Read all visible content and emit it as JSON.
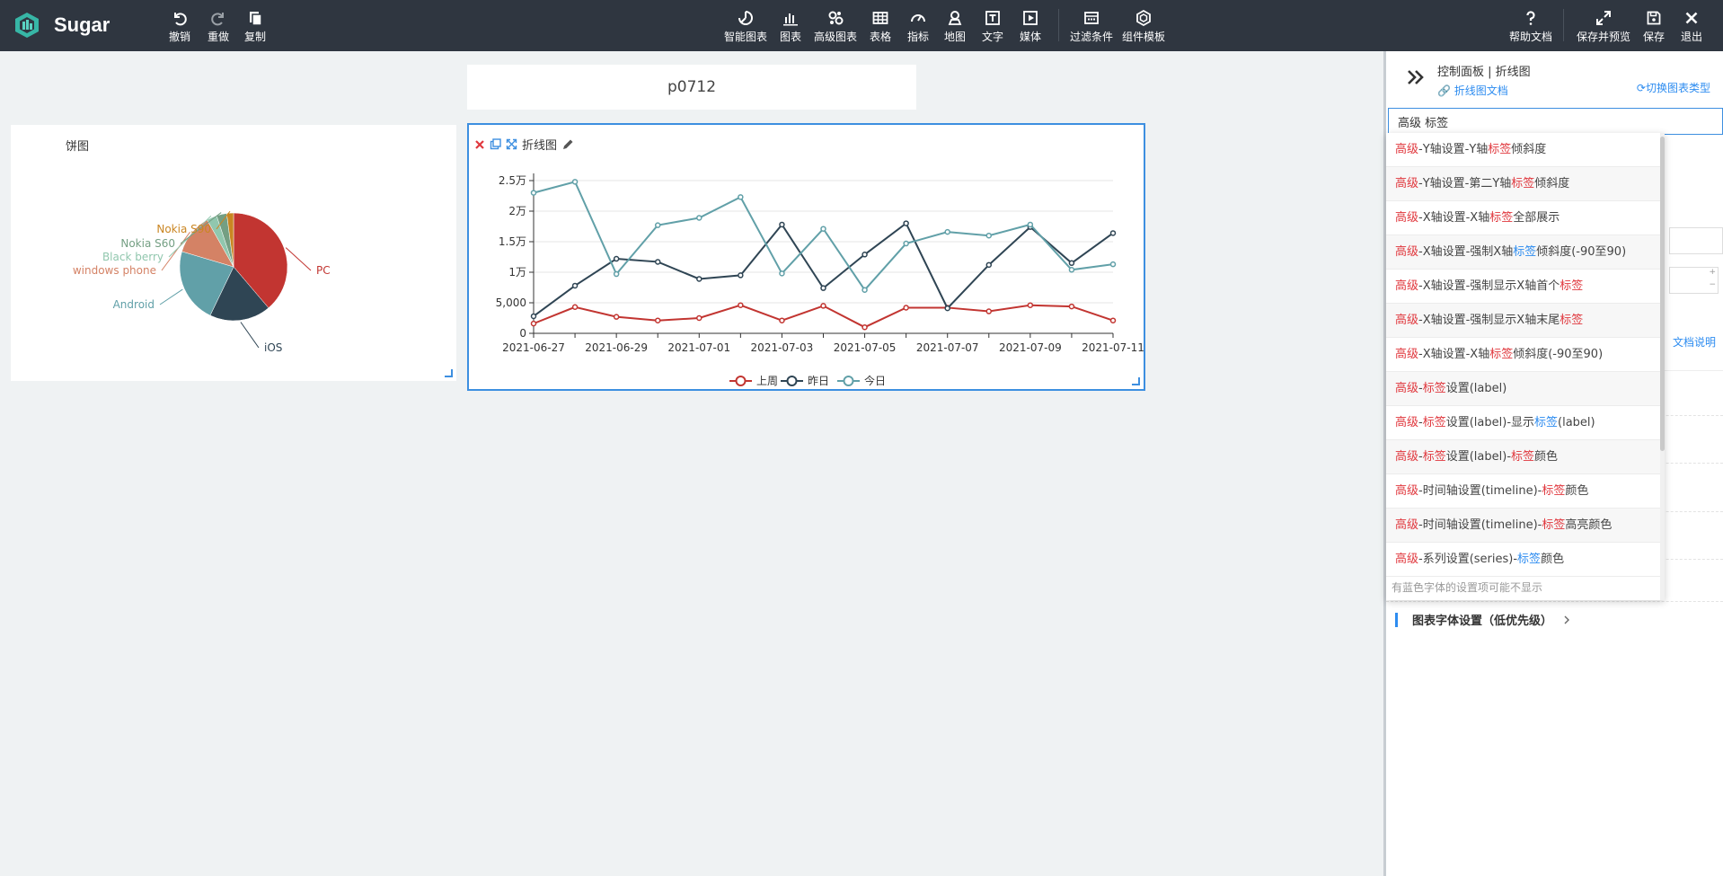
{
  "app": {
    "name": "Sugar"
  },
  "toolbar": {
    "left": [
      {
        "label": "撤销",
        "icon": "undo-icon"
      },
      {
        "label": "重做",
        "icon": "redo-icon"
      },
      {
        "label": "复制",
        "icon": "copy-icon"
      }
    ],
    "center": [
      {
        "label": "智能图表",
        "icon": "smart-chart-icon"
      },
      {
        "label": "图表",
        "icon": "bar-chart-icon"
      },
      {
        "label": "高级图表",
        "icon": "advanced-chart-icon"
      },
      {
        "label": "表格",
        "icon": "table-icon"
      },
      {
        "label": "指标",
        "icon": "gauge-icon"
      },
      {
        "label": "地图",
        "icon": "map-pin-icon"
      },
      {
        "label": "文字",
        "icon": "text-icon"
      },
      {
        "label": "媒体",
        "icon": "media-icon"
      },
      {
        "label": "过滤条件",
        "icon": "filter-icon"
      },
      {
        "label": "组件模板",
        "icon": "template-icon"
      }
    ],
    "right": [
      {
        "label": "帮助文档",
        "icon": "help-icon"
      },
      {
        "label": "保存并预览",
        "icon": "expand-icon"
      },
      {
        "label": "保存",
        "icon": "save-icon"
      },
      {
        "label": "退出",
        "icon": "close-icon"
      }
    ]
  },
  "page_title": "p0712",
  "pie_card": {
    "title": "饼图",
    "chart_data": {
      "type": "pie",
      "slices": [
        {
          "name": "PC",
          "value": 38,
          "color": "#c23531"
        },
        {
          "name": "iOS",
          "value": 18,
          "color": "#2f4554"
        },
        {
          "name": "Android",
          "value": 22,
          "color": "#61a0a8"
        },
        {
          "name": "windows phone",
          "value": 12,
          "color": "#d48265"
        },
        {
          "name": "Black berry",
          "value": 3,
          "color": "#91c7ae"
        },
        {
          "name": "Nokia S60",
          "value": 3,
          "color": "#749f83"
        },
        {
          "name": "Nokia S90",
          "value": 2,
          "color": "#ca8622"
        }
      ]
    }
  },
  "line_card": {
    "title": "折线图",
    "chart_data": {
      "type": "line",
      "x": [
        "2021-06-27",
        "2021-06-28",
        "2021-06-29",
        "2021-06-30",
        "2021-07-01",
        "2021-07-02",
        "2021-07-03",
        "2021-07-04",
        "2021-07-05",
        "2021-07-06",
        "2021-07-07",
        "2021-07-08",
        "2021-07-09",
        "2021-07-10",
        "2021-07-11"
      ],
      "x_ticks": [
        "2021-06-27",
        "2021-06-29",
        "2021-07-01",
        "2021-07-03",
        "2021-07-05",
        "2021-07-07",
        "2021-07-09",
        "2021-07-11"
      ],
      "y_ticks": [
        {
          "value": 0,
          "label": "0"
        },
        {
          "value": 5000,
          "label": "5,000"
        },
        {
          "value": 10000,
          "label": "1万"
        },
        {
          "value": 15000,
          "label": "1.5万"
        },
        {
          "value": 20000,
          "label": "2万"
        },
        {
          "value": 25000,
          "label": "2.5万"
        }
      ],
      "ylim": [
        0,
        25000
      ],
      "grid": true,
      "legend": "bottom",
      "series": [
        {
          "name": "上周",
          "color": "#c23531",
          "values": [
            1600,
            4300,
            2700,
            2100,
            2500,
            4600,
            2100,
            4500,
            1000,
            4200,
            4200,
            3600,
            4600,
            4400,
            2100
          ]
        },
        {
          "name": "昨日",
          "color": "#2f4554",
          "values": [
            2800,
            7800,
            12200,
            11700,
            8900,
            9500,
            17800,
            7400,
            12900,
            18000,
            4100,
            11200,
            17400,
            11500,
            16400
          ]
        },
        {
          "name": "今日",
          "color": "#61a0a8",
          "values": [
            23000,
            24800,
            9700,
            17700,
            18900,
            22300,
            9800,
            17100,
            7100,
            14700,
            16600,
            16000,
            17800,
            10400,
            11300
          ]
        }
      ]
    }
  },
  "panel": {
    "title": "控制面板 | 折线图",
    "doc_link": "折线图文档",
    "switch_type": "切换图表类型",
    "search_value": "高级 标签",
    "hint": "有蓝色字体的设置项可能不显示",
    "doc_explain": "文档说明",
    "font_section": "图表字体设置（低优先级）",
    "results": [
      [
        [
          "r",
          "高级"
        ],
        [
          "n",
          "-Y轴设置-Y轴"
        ],
        [
          "r",
          "标签"
        ],
        [
          "n",
          "倾斜度"
        ]
      ],
      [
        [
          "r",
          "高级"
        ],
        [
          "n",
          "-Y轴设置-第二Y轴"
        ],
        [
          "r",
          "标签"
        ],
        [
          "n",
          "倾斜度"
        ]
      ],
      [
        [
          "r",
          "高级"
        ],
        [
          "n",
          "-X轴设置-X轴"
        ],
        [
          "r",
          "标签"
        ],
        [
          "n",
          "全部展示"
        ]
      ],
      [
        [
          "r",
          "高级"
        ],
        [
          "n",
          "-X轴设置-强制X轴"
        ],
        [
          "b",
          "标签"
        ],
        [
          "n",
          "倾斜度(-90至90)"
        ]
      ],
      [
        [
          "r",
          "高级"
        ],
        [
          "n",
          "-X轴设置-强制显示X轴首个"
        ],
        [
          "r",
          "标签"
        ]
      ],
      [
        [
          "r",
          "高级"
        ],
        [
          "n",
          "-X轴设置-强制显示X轴末尾"
        ],
        [
          "r",
          "标签"
        ]
      ],
      [
        [
          "r",
          "高级"
        ],
        [
          "n",
          "-X轴设置-X轴"
        ],
        [
          "r",
          "标签"
        ],
        [
          "n",
          "倾斜度(-90至90)"
        ]
      ],
      [
        [
          "r",
          "高级"
        ],
        [
          "n",
          "-"
        ],
        [
          "r",
          "标签"
        ],
        [
          "n",
          "设置(label)"
        ]
      ],
      [
        [
          "r",
          "高级"
        ],
        [
          "n",
          "-"
        ],
        [
          "r",
          "标签"
        ],
        [
          "n",
          "设置(label)-显示"
        ],
        [
          "b",
          "标签"
        ],
        [
          "n",
          "(label)"
        ]
      ],
      [
        [
          "r",
          "高级"
        ],
        [
          "n",
          "-"
        ],
        [
          "r",
          "标签"
        ],
        [
          "n",
          "设置(label)-"
        ],
        [
          "r",
          "标签"
        ],
        [
          "n",
          "颜色"
        ]
      ],
      [
        [
          "r",
          "高级"
        ],
        [
          "n",
          "-时间轴设置(timeline)-"
        ],
        [
          "r",
          "标签"
        ],
        [
          "n",
          "颜色"
        ]
      ],
      [
        [
          "r",
          "高级"
        ],
        [
          "n",
          "-时间轴设置(timeline)-"
        ],
        [
          "r",
          "标签"
        ],
        [
          "n",
          "高亮颜色"
        ]
      ],
      [
        [
          "r",
          "高级"
        ],
        [
          "n",
          "-系列设置(series)-"
        ],
        [
          "b",
          "标签"
        ],
        [
          "n",
          "颜色"
        ]
      ]
    ]
  }
}
